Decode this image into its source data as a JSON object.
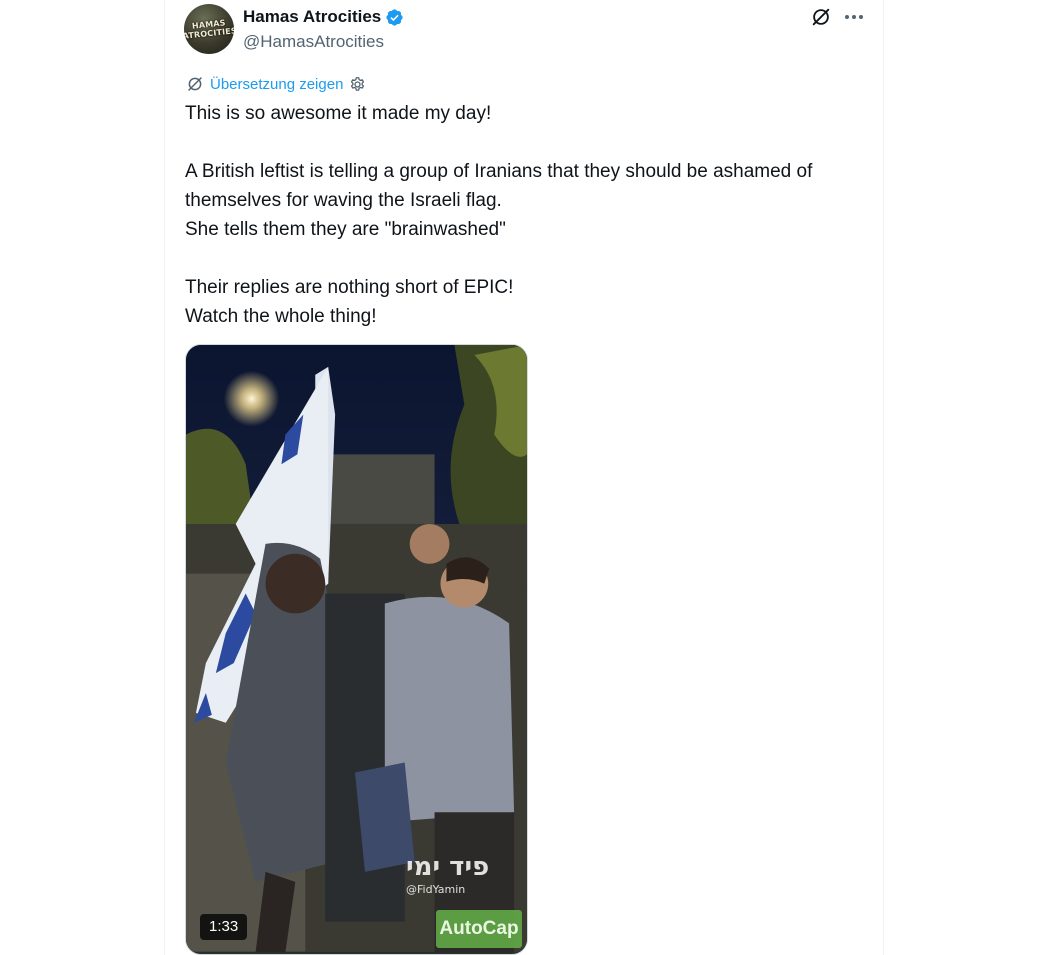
{
  "author": {
    "name": "Hamas Atrocities",
    "handle": "@HamasAtrocities",
    "avatar_text": "HAMAS ATROCITIES",
    "verified": true,
    "verified_color": "#1d9bf0"
  },
  "actions": {
    "grok_icon": "grok-icon",
    "more_icon": "more-icon"
  },
  "translate": {
    "label": "Übersetzung zeigen",
    "icon": "translate-icon",
    "settings_icon": "gear-icon",
    "color": "#1d9bf0"
  },
  "tweet": {
    "text": "This is so awesome it made my day!\n\nA British leftist is telling a group of Iranians that they should be ashamed of themselves for waving the Israeli flag.\nShe tells them they are \"brainwashed\"\n\nTheir replies are nothing short of EPIC!\nWatch the whole thing!"
  },
  "media": {
    "duration": "1:33",
    "autocap_label": "AutoCap",
    "watermark_main": "פיד ימי",
    "watermark_sub": "@FidYamin"
  }
}
